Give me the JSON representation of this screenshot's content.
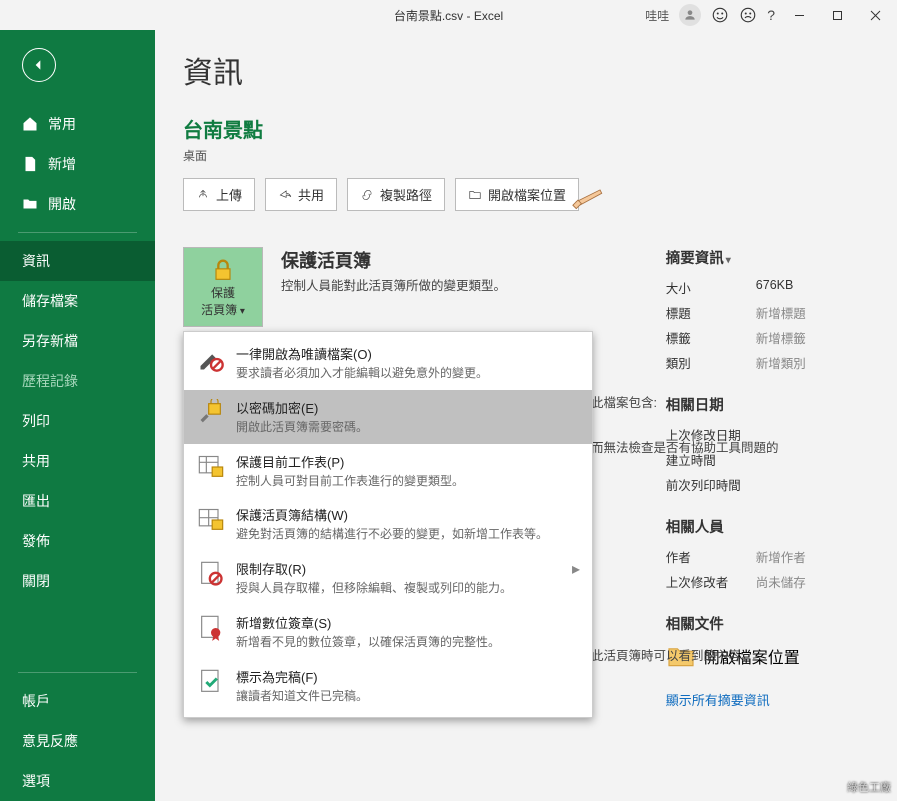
{
  "titlebar": {
    "title": "台南景點.csv - Excel",
    "user": "哇哇"
  },
  "sidebar": {
    "items": [
      {
        "label": "常用"
      },
      {
        "label": "新增"
      },
      {
        "label": "開啟"
      },
      {
        "label": "資訊"
      },
      {
        "label": "儲存檔案"
      },
      {
        "label": "另存新檔"
      },
      {
        "label": "歷程記錄"
      },
      {
        "label": "列印"
      },
      {
        "label": "共用"
      },
      {
        "label": "匯出"
      },
      {
        "label": "發佈"
      },
      {
        "label": "關閉"
      },
      {
        "label": "帳戶"
      },
      {
        "label": "意見反應"
      },
      {
        "label": "選項"
      }
    ]
  },
  "content": {
    "h1": "資訊",
    "doc_title": "台南景點",
    "doc_loc": "桌面",
    "buttons": {
      "upload": "上傳",
      "share": "共用",
      "copypath": "複製路徑",
      "openloc": "開啟檔案位置"
    },
    "protect": {
      "btn_line1": "保護",
      "btn_line2": "活頁簿",
      "title": "保護活頁簿",
      "desc": "控制人員能對此活頁簿所做的變更類型。"
    },
    "menu": [
      {
        "title": "一律開啟為唯讀檔案(O)",
        "desc": "要求讀者必須加入才能編輯以避免意外的變更。"
      },
      {
        "title": "以密碼加密(E)",
        "desc": "開啟此活頁簿需要密碼。"
      },
      {
        "title": "保護目前工作表(P)",
        "desc": "控制人員可對目前工作表進行的變更類型。"
      },
      {
        "title": "保護活頁簿結構(W)",
        "desc": "避免對活頁簿的結構進行不必要的變更，如新增工作表等。"
      },
      {
        "title": "限制存取(R)",
        "desc": "授與人員存取權，但移除編輯、複製或列印的能力。"
      },
      {
        "title": "新增數位簽章(S)",
        "desc": "新增看不見的數位簽章，以確保活頁簿的完整性。"
      },
      {
        "title": "標示為完稿(F)",
        "desc": "讓讀者知道文件已完稿。"
      }
    ],
    "behind1": {
      "l1": "此檔案包含:",
      "l2": "而無法檢查是否有協助工具問題的"
    },
    "behind2": "此活頁簿時可以看到的內容。",
    "props": {
      "head": "摘要資訊",
      "size_l": "大小",
      "size_v": "676KB",
      "title_l": "標題",
      "title_v": "新增標題",
      "tags_l": "標籤",
      "tags_v": "新增標籤",
      "cat_l": "類別",
      "cat_v": "新增類別",
      "dates_head": "相關日期",
      "mod_l": "上次修改日期",
      "created_l": "建立時間",
      "print_l": "前次列印時間",
      "people_head": "相關人員",
      "author_l": "作者",
      "author_v": "新增作者",
      "modby_l": "上次修改者",
      "modby_v": "尚未儲存",
      "docs_head": "相關文件",
      "openloc": "開啟檔案位置",
      "showall": "顯示所有摘要資訊"
    }
  },
  "watermark": "綠色工廠"
}
